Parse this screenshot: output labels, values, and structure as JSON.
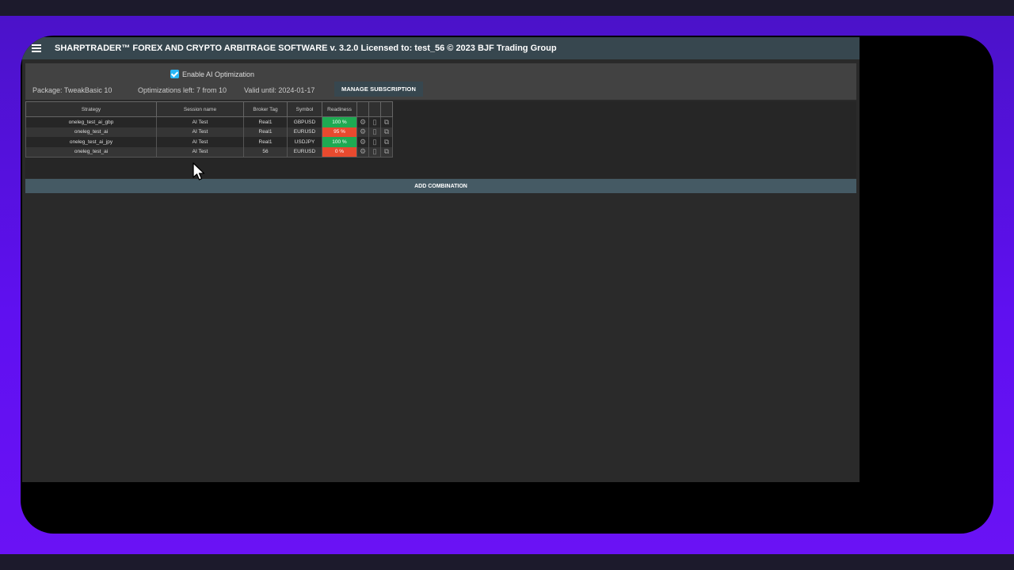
{
  "titlebar": {
    "title": "SHARPTRADER™ FOREX AND CRYPTO ARBITRAGE SOFTWARE v. 3.2.0 Licensed to: test_56 © 2023 BJF Trading Group",
    "menu_icon": "hamburger-menu-icon"
  },
  "subscription": {
    "ai_checkbox_label": "Enable AI Optimization",
    "ai_checkbox_checked": true,
    "package": "Package: TweakBasic 10",
    "optimizations": "Optimizations left: 7 from 10",
    "valid_until": "Valid until: 2024-01-17",
    "manage_button": "MANAGE SUBSCRIPTION"
  },
  "table": {
    "headers": [
      "Strategy",
      "Session name",
      "Broker Tag",
      "Symbol",
      "Readiness",
      "",
      "",
      ""
    ],
    "rows": [
      {
        "strategy": "oneleg_test_ai_gbp",
        "session": "AI Test",
        "broker": "Real1",
        "symbol": "GBPUSD",
        "readiness": "100 %",
        "status": "green"
      },
      {
        "strategy": "oneleg_test_ai",
        "session": "AI Test",
        "broker": "Real1",
        "symbol": "EURUSD",
        "readiness": "95 %",
        "status": "red"
      },
      {
        "strategy": "oneleg_test_ai_jpy",
        "session": "AI Test",
        "broker": "Real1",
        "symbol": "USDJPY",
        "readiness": "100 %",
        "status": "green"
      },
      {
        "strategy": "oneleg_test_ai",
        "session": "AI Test",
        "broker": "56",
        "symbol": "EURUSD",
        "readiness": "0 %",
        "status": "red"
      }
    ],
    "row_actions": [
      "gear-icon",
      "trash-icon",
      "edit-icon"
    ]
  },
  "add_combination": "ADD COMBINATION",
  "colors": {
    "ready_green": "#1faa52",
    "ready_red": "#e84a2f",
    "accent": "#29b6f6",
    "titlebar": "#37474f"
  }
}
